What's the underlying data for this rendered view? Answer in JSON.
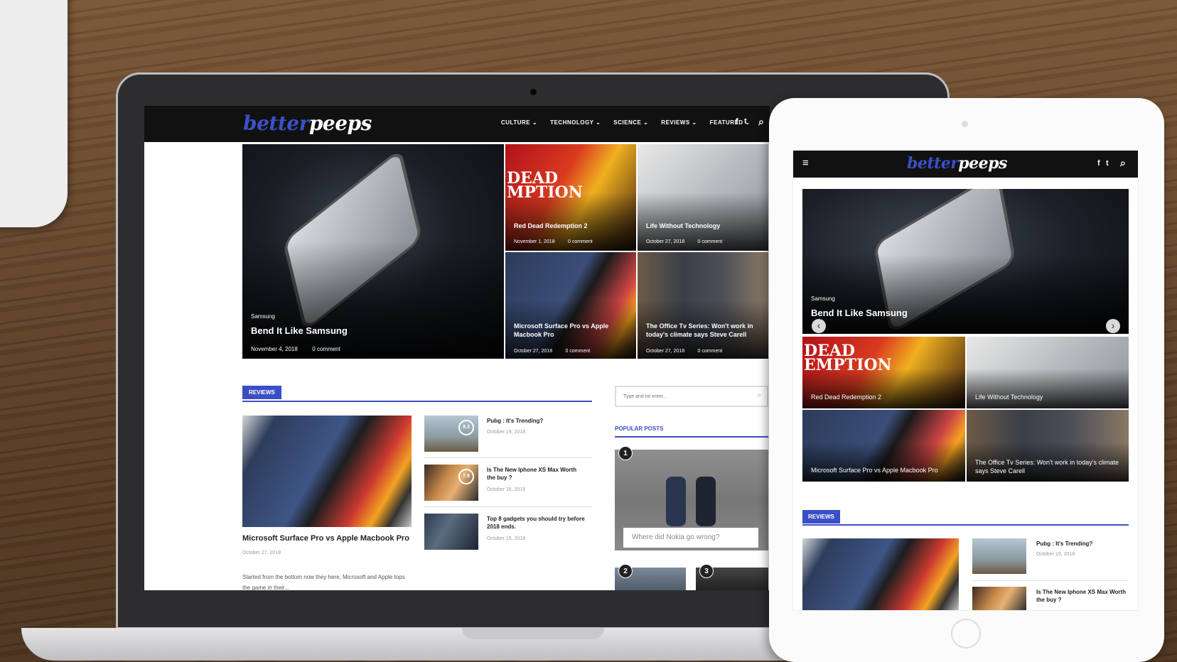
{
  "site": {
    "logo_a": "better",
    "logo_b": "peeps"
  },
  "nav": [
    "CULTURE ⌄",
    "TECHNOLOGY ⌄",
    "SCIENCE ⌄",
    "REVIEWS ⌄",
    "FEATURED ⌄"
  ],
  "icons": {
    "facebook": "f",
    "twitter": "t",
    "search": "⌕",
    "menu": "≡"
  },
  "hero": {
    "category": "Samsung",
    "title": "Bend It Like Samsung",
    "date": "November 4, 2018",
    "comments": "0 comment"
  },
  "grid": [
    {
      "title": "Red Dead Redemption 2",
      "date": "November 1, 2018",
      "comments": "0 comment"
    },
    {
      "title": "Life Without Technology",
      "date": "October 27, 2018",
      "comments": "0 comment"
    },
    {
      "title": "Microsoft Surface Pro vs Apple Macbook Pro",
      "date": "October 27, 2018",
      "comments": "0 comment"
    },
    {
      "title": "The Office Tv Series: Won't work in today's climate says Steve Carell",
      "date": "October 27, 2018",
      "comments": "0 comment"
    }
  ],
  "reviews": {
    "label": "REVIEWS",
    "main": {
      "title": "Microsoft Surface Pro vs Apple Macbook Pro",
      "date": "October 27, 2018",
      "excerpt": "Started from the bottom now they here, Microsoft and Apple tops the game in their..."
    },
    "list": [
      {
        "title": "Pubg : It's Trending?",
        "date": "October 19, 2018",
        "score": "8.3"
      },
      {
        "title": "Is The New Iphone XS Max Worth the buy ?",
        "date": "October 16, 2018",
        "score": "7.8"
      },
      {
        "title": "Top 8 gadgets you should try before 2018 ends.",
        "date": "October 15, 2018"
      }
    ]
  },
  "sidebar": {
    "search_placeholder": "Type and hit enter...",
    "popular_label": "POPULAR POSTS",
    "popular_first": "Where did Nokia go wrong?",
    "nums": [
      "1",
      "2",
      "3"
    ]
  },
  "tablet": {
    "hero_category": "Samsung",
    "hero_title": "Bend It Like Samsung",
    "grid": [
      "Red Dead Redemption 2",
      "Life Without Technology",
      "Microsoft Surface Pro vs Apple Macbook Pro",
      "The Office Tv Series: Won't work in today's climate says Steve Carell"
    ],
    "reviews_label": "REVIEWS",
    "list": [
      {
        "title": "Pubg : It's Trending?",
        "date": "October 19, 2018"
      },
      {
        "title": "Is The New Iphone XS Max Worth the buy ?"
      }
    ],
    "arrow_left": "‹",
    "arrow_right": "›"
  },
  "colors": {
    "accent": "#3a4fc6",
    "topbar": "#111111"
  }
}
